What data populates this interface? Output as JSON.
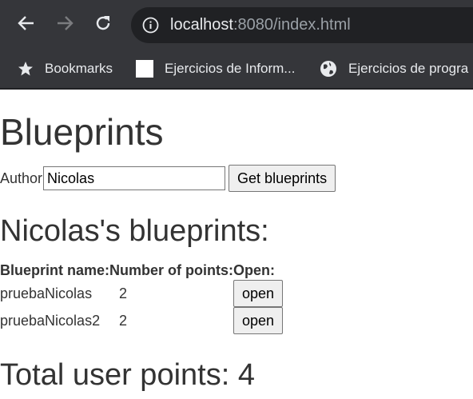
{
  "browser": {
    "url_host": "localhost",
    "url_rest": ":8080/index.html",
    "bookmarks": [
      {
        "label": "Bookmarks",
        "icon": "star-icon"
      },
      {
        "label": "Ejercicios de Inform...",
        "icon": "page-icon"
      },
      {
        "label": "Ejercicios de progra",
        "icon": "globe-icon"
      }
    ]
  },
  "page": {
    "title": "Blueprints",
    "author_label": "Author",
    "author_value": "Nicolas",
    "get_button": "Get blueprints",
    "subtitle": "Nicolas's blueprints:",
    "table": {
      "headers": [
        "Blueprint name:",
        "Number of points:",
        "Open:"
      ],
      "rows": [
        {
          "name": "pruebaNicolas",
          "points": "2",
          "open": "open"
        },
        {
          "name": "pruebaNicolas2",
          "points": "2",
          "open": "open"
        }
      ]
    },
    "total": "Total user points: 4"
  },
  "colors": {
    "chrome_bg": "#35363a",
    "omnibox_bg": "#202124",
    "text": "#333333"
  }
}
